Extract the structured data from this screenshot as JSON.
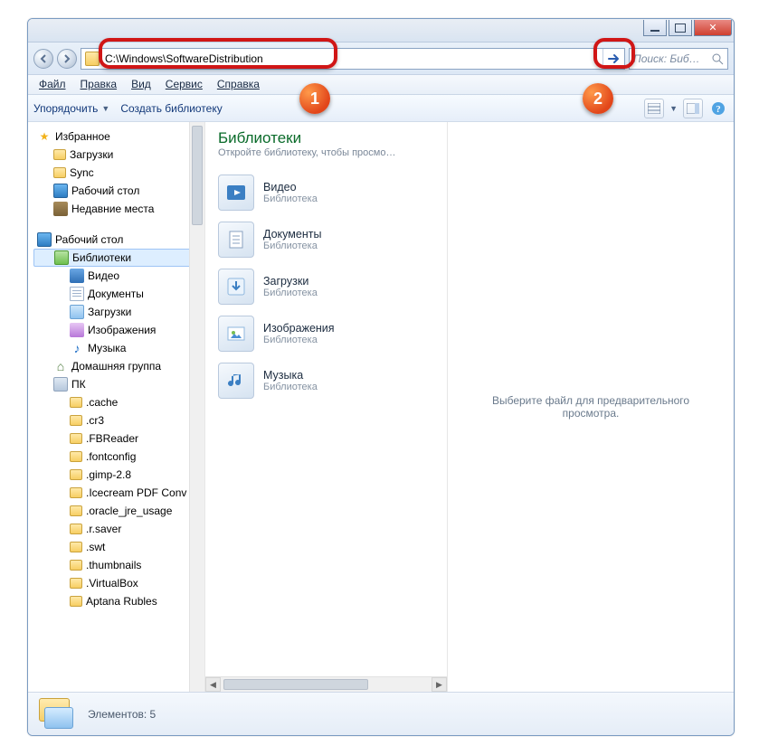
{
  "address": {
    "path": "C:\\Windows\\SoftwareDistribution"
  },
  "search": {
    "placeholder": "Поиск: Биб…"
  },
  "menu": {
    "file": "Файл",
    "edit": "Правка",
    "view": "Вид",
    "tools": "Сервис",
    "help": "Справка"
  },
  "toolbar": {
    "organize": "Упорядочить",
    "create_lib": "Создать библиотеку"
  },
  "sidebar": {
    "favorites": {
      "title": "Избранное",
      "downloads": "Загрузки",
      "sync": "Sync",
      "desktop": "Рабочий стол",
      "recent": "Недавние места"
    },
    "desktop": {
      "title": "Рабочий стол"
    },
    "libraries": {
      "title": "Библиотеки",
      "video": "Видео",
      "documents": "Документы",
      "downloads": "Загрузки",
      "images": "Изображения",
      "music": "Музыка"
    },
    "homegroup": "Домашняя группа",
    "pc": {
      "title": "ПК",
      "folders": [
        ".cache",
        ".cr3",
        ".FBReader",
        ".fontconfig",
        ".gimp-2.8",
        ".Icecream PDF Conv",
        ".oracle_jre_usage",
        ".r.saver",
        ".swt",
        ".thumbnails",
        ".VirtualBox",
        "Aptana Rubles"
      ]
    }
  },
  "main": {
    "title": "Библиотеки",
    "subtitle": "Откройте библиотеку, чтобы просмо…",
    "library_type": "Библиотека",
    "items": {
      "video": "Видео",
      "documents": "Документы",
      "downloads": "Загрузки",
      "images": "Изображения",
      "music": "Музыка"
    }
  },
  "preview": {
    "empty": "Выберите файл для предварительного просмотра."
  },
  "status": {
    "label": "Элементов: 5"
  },
  "callouts": {
    "one": "1",
    "two": "2"
  }
}
